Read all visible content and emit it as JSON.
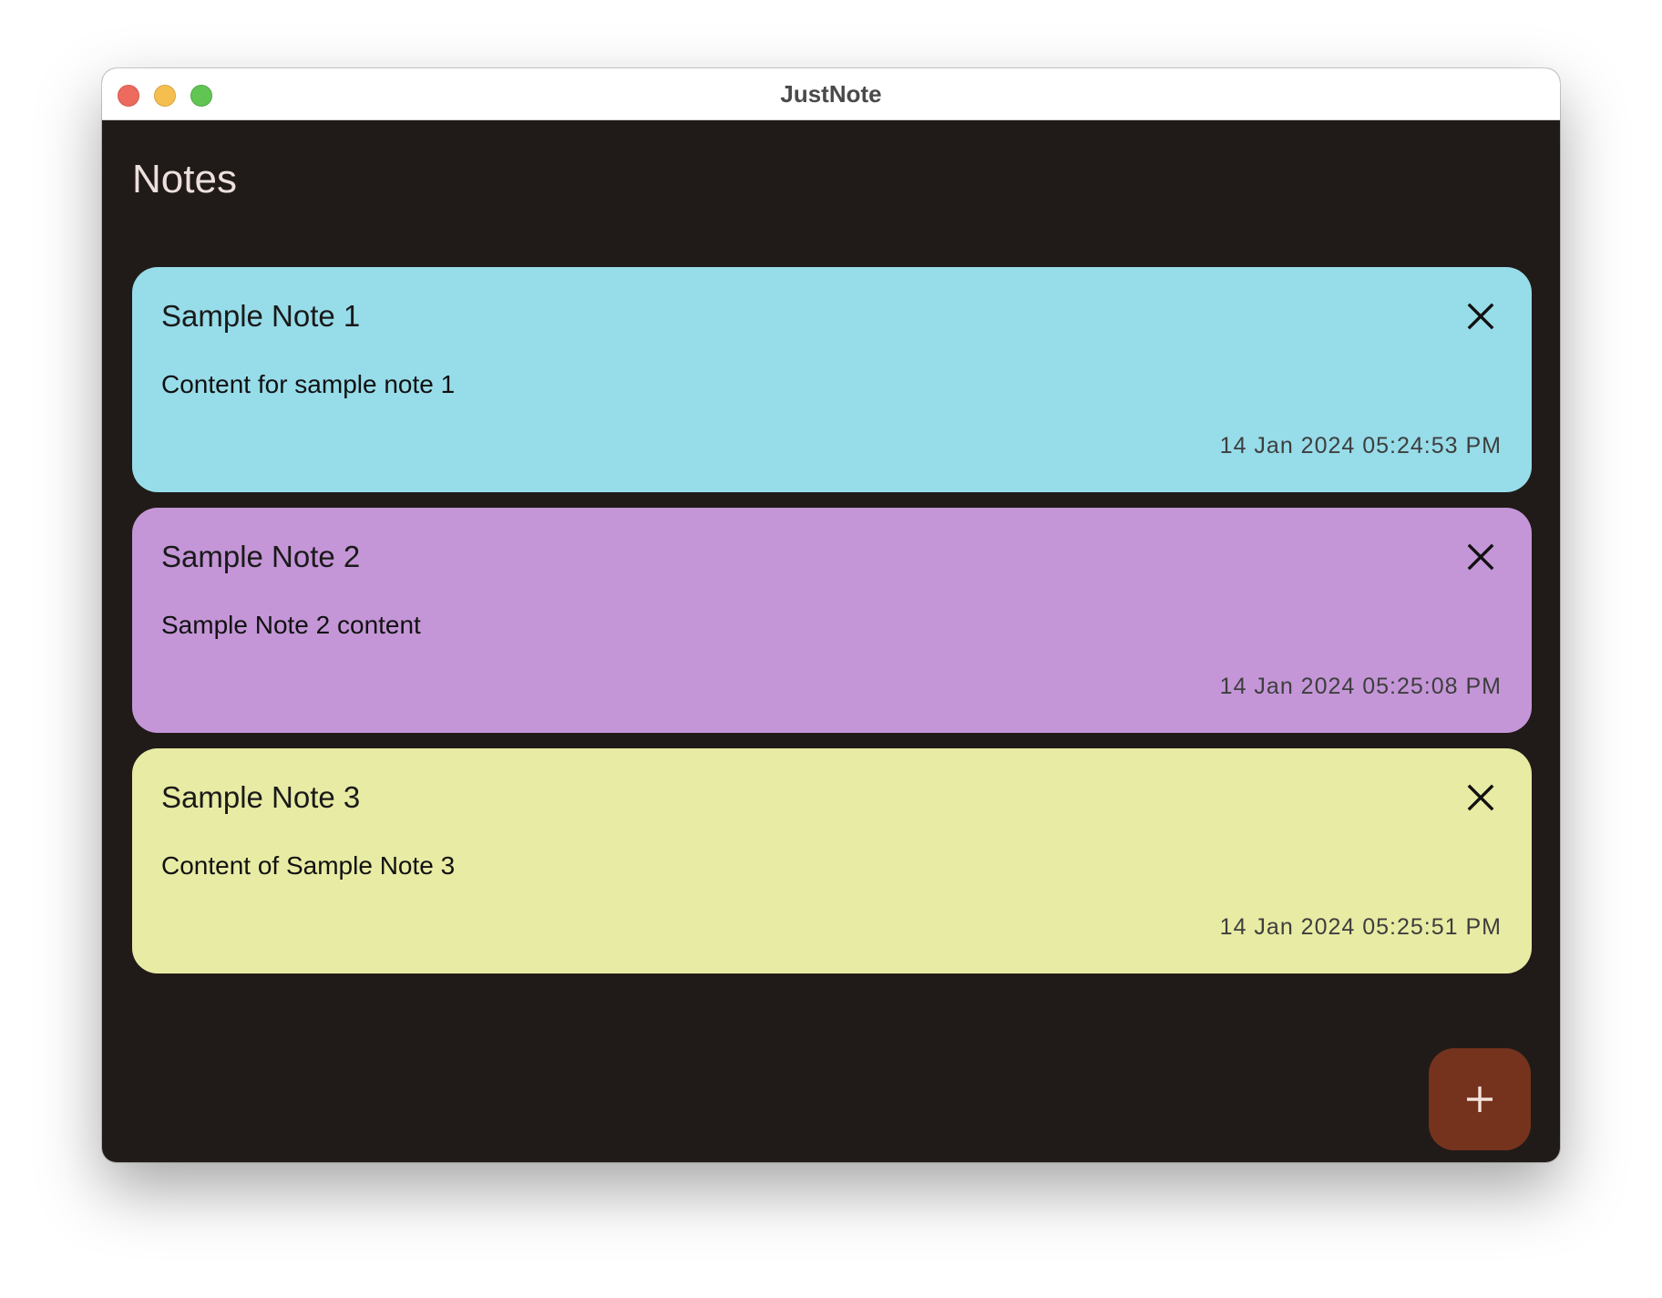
{
  "window": {
    "title": "JustNote"
  },
  "header": {
    "title": "Notes"
  },
  "notes": [
    {
      "title": "Sample Note 1",
      "content": "Content for sample note 1",
      "date": "14 Jan 2024 05:24:53 PM",
      "color": "#97dce9"
    },
    {
      "title": "Sample Note 2",
      "content": "Sample Note 2 content",
      "date": "14 Jan 2024 05:25:08 PM",
      "color": "#c496d7"
    },
    {
      "title": "Sample Note 3",
      "content": "Content of Sample Note 3",
      "date": "14 Jan 2024 05:25:51 PM",
      "color": "#e8eba3"
    }
  ],
  "icons": {
    "delete": "close-icon",
    "add": "plus-icon"
  },
  "colors": {
    "background": "#201b19",
    "fab": "#75331d",
    "title_text": "#ede0dc"
  }
}
